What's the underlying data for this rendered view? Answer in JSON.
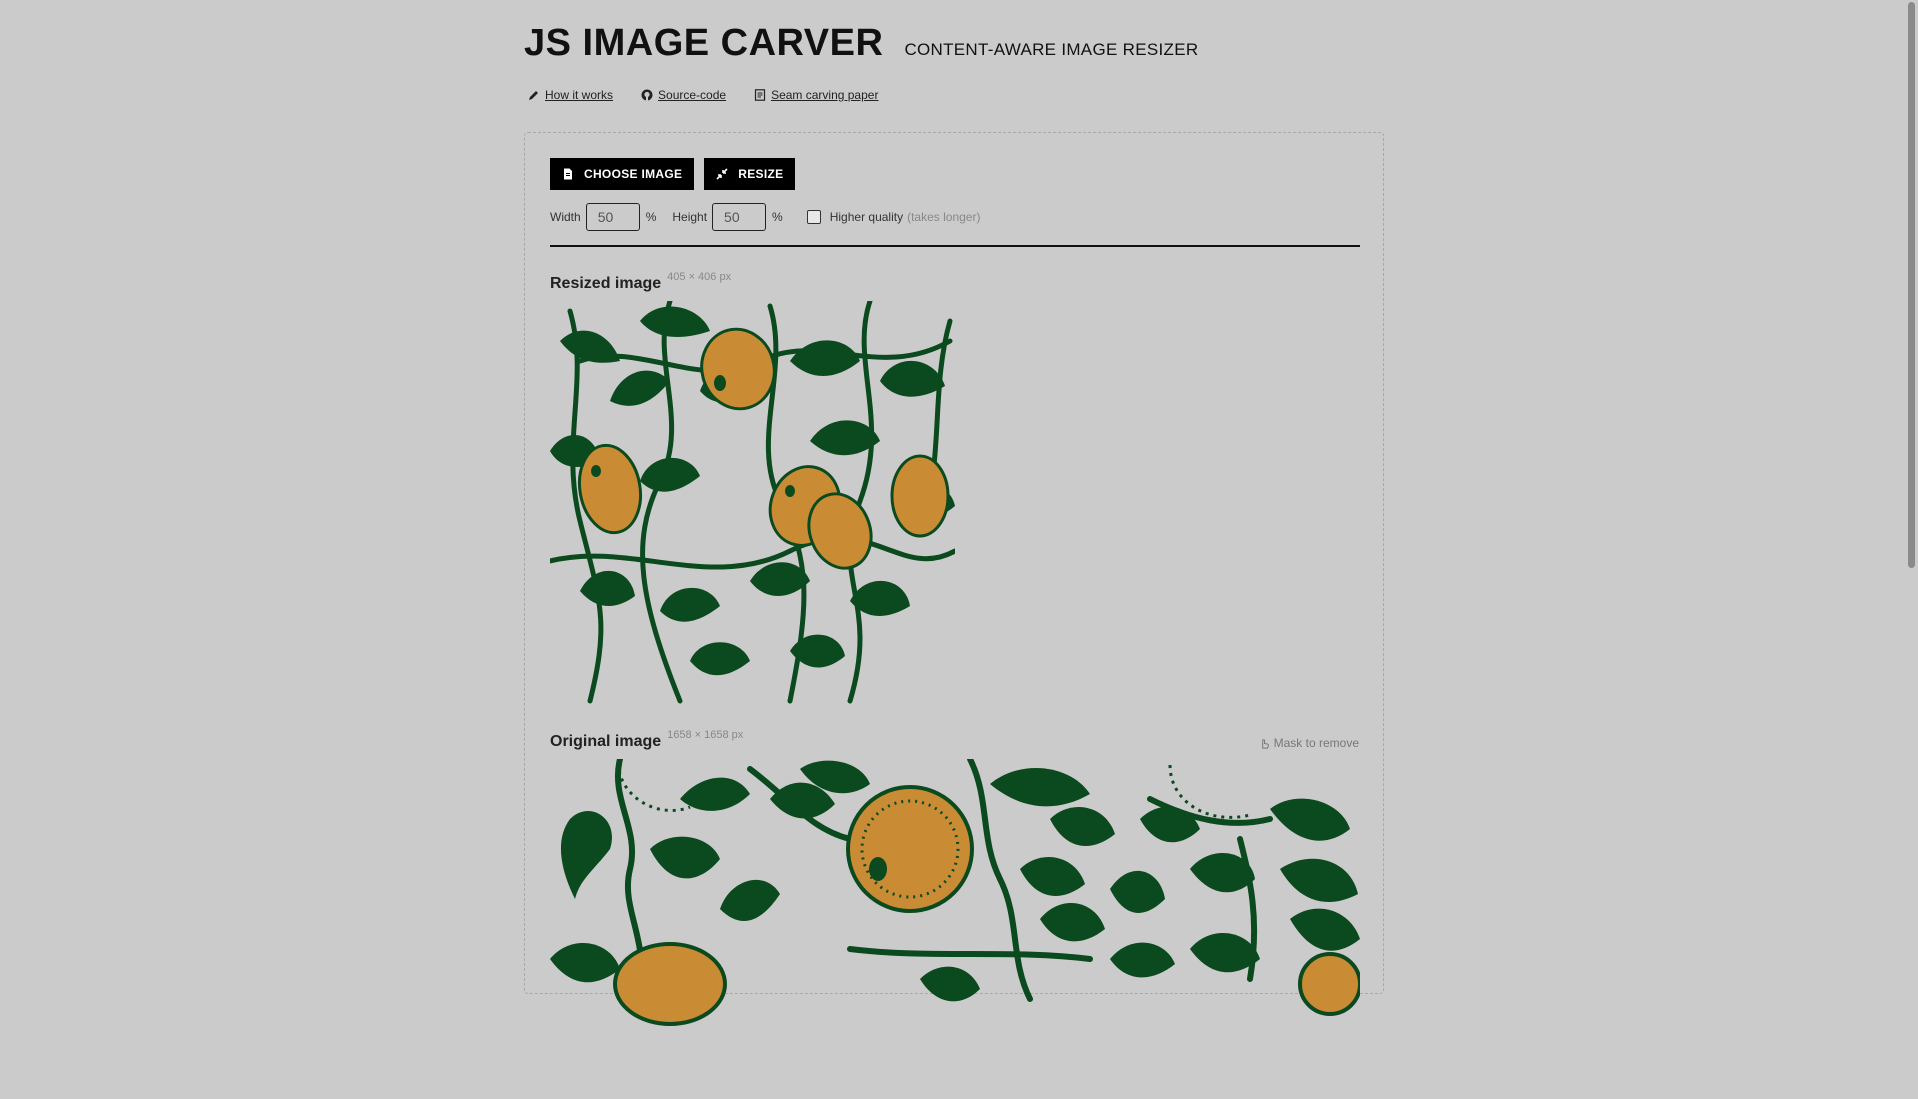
{
  "app": {
    "title": "JS IMAGE CARVER",
    "subtitle": "CONTENT-AWARE IMAGE RESIZER"
  },
  "links": [
    {
      "label": "How it works",
      "icon": "pencil-icon"
    },
    {
      "label": "Source-code",
      "icon": "github-icon"
    },
    {
      "label": "Seam carving paper",
      "icon": "document-icon"
    }
  ],
  "toolbar": {
    "choose_label": "CHOOSE IMAGE",
    "choose_icon": "file-icon",
    "resize_label": "RESIZE",
    "resize_icon": "shrink-icon"
  },
  "controls": {
    "width_label": "Width",
    "width_value": "50",
    "width_unit": "%",
    "height_label": "Height",
    "height_value": "50",
    "height_unit": "%",
    "quality_label": "Higher quality",
    "quality_hint": "(takes longer)",
    "quality_checked": false
  },
  "resized": {
    "label": "Resized image",
    "dimensions": "405 × 406 px"
  },
  "original": {
    "label": "Original image",
    "dimensions": "1658 × 1658 px",
    "mask_label": "Mask to remove",
    "mask_icon": "pointer-hand-icon"
  },
  "colors": {
    "background": "#cbcbcb",
    "leaf": "#0b4a1e",
    "fruit": "#c98c35",
    "button": "#000000"
  }
}
